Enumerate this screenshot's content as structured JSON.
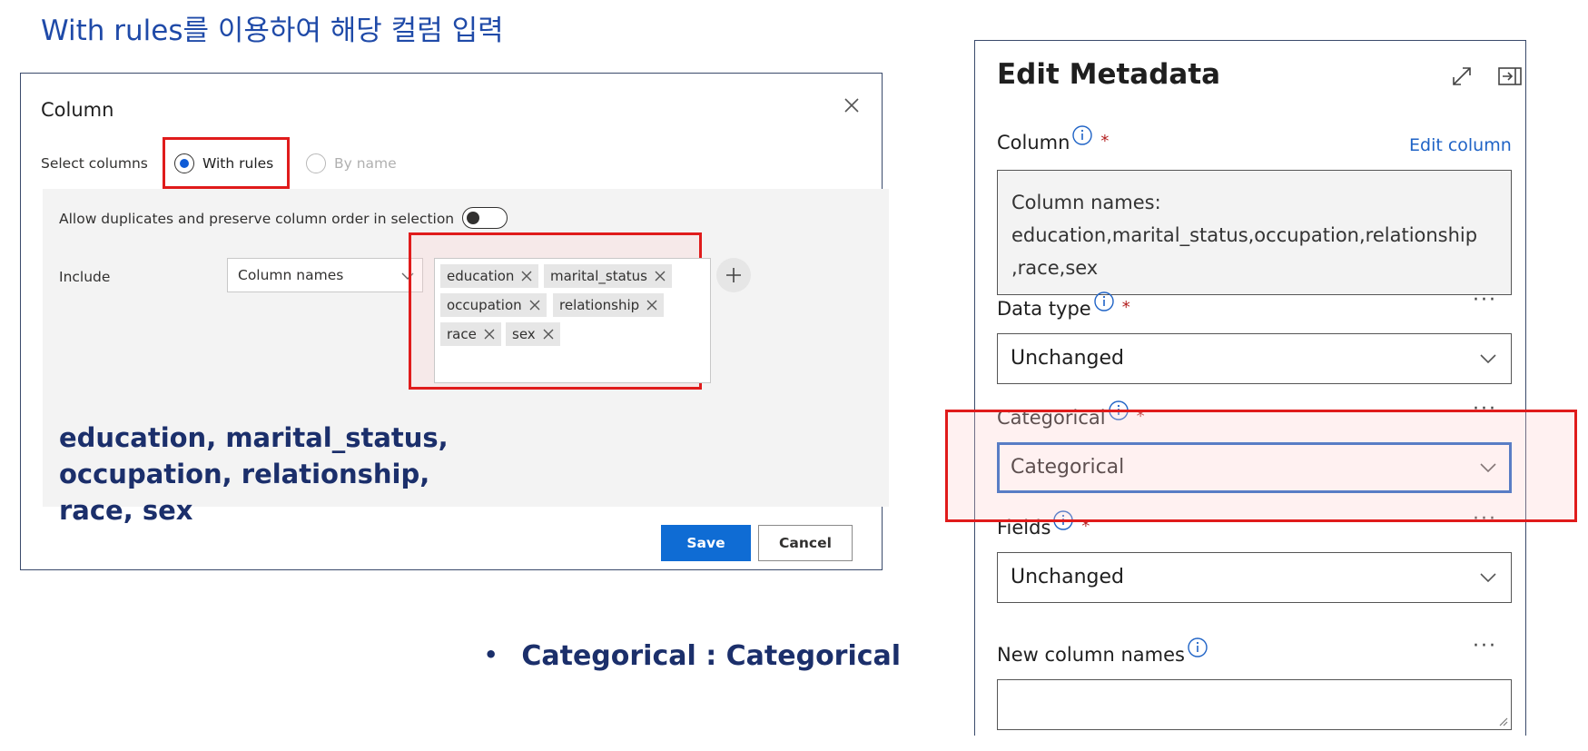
{
  "slide_title": "With rules를 이용하여 해당 컬럼 입력",
  "column_dialog": {
    "title": "Column",
    "select_columns_label": "Select columns",
    "radio_with_rules": "With rules",
    "radio_by_name": "By name",
    "selected_radio": "With rules",
    "allow_duplicates_label": "Allow duplicates and preserve column order in selection",
    "allow_duplicates_enabled": false,
    "include_label": "Include",
    "include_select_value": "Column names",
    "tags": [
      "education",
      "marital_status",
      "occupation",
      "relationship",
      "race",
      "sex"
    ],
    "save_label": "Save",
    "cancel_label": "Cancel"
  },
  "annotation_lines": [
    "education, marital_status,",
    "occupation, relationship,",
    "race, sex"
  ],
  "bullet_text": "Categorical : Categorical",
  "edit_metadata": {
    "title": "Edit Metadata",
    "column_label": "Column",
    "edit_column_link": "Edit column",
    "column_names_lines": [
      "Column names:",
      "education,marital_status,occupation,relationship",
      ",race,sex"
    ],
    "data_type_label": "Data type",
    "data_type_value": "Unchanged",
    "categorical_label": "Categorical",
    "categorical_value": "Categorical",
    "fields_label": "Fields",
    "fields_value": "Unchanged",
    "new_column_names_label": "New column names",
    "new_column_names_value": "",
    "required_mark": "*",
    "more_label": "···"
  },
  "colors": {
    "title_blue": "#1f4aa8",
    "annotation_navy": "#1b2f6b",
    "highlight_red": "#e01b1b",
    "primary_button": "#0f6cd4",
    "focus_border": "#1a5fc2",
    "link_blue": "#1f63c6"
  },
  "icons": {
    "close": "close-icon",
    "tag_remove": "remove-tag-icon",
    "add": "plus-icon",
    "chevron": "chevron-down-icon",
    "info": "info-icon",
    "expand": "expand-icon",
    "dock": "dock-panel-icon"
  }
}
